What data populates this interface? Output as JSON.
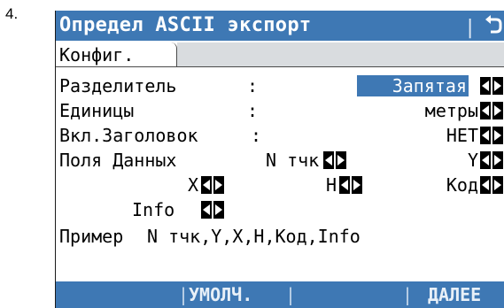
{
  "step_number": "4.",
  "title": "Определ ASCII экспорт",
  "title_separator": "|",
  "tabs": [
    "Конфиг."
  ],
  "fields": {
    "separator": {
      "label": "Разделитель",
      "colon": ":",
      "value": "Запятая"
    },
    "units": {
      "label": "Единицы",
      "colon": ":",
      "value": "метры"
    },
    "header": {
      "label": "Вкл.Заголовок",
      "colon": ":",
      "value": "НЕТ"
    }
  },
  "data_fields": {
    "label": "Поля Данных",
    "point_no": "N тчк",
    "y": "Y",
    "x": "X",
    "h": "H",
    "code": "Код",
    "info": "Info"
  },
  "example": {
    "label": "Пример",
    "text": "N тчк,Y,X,H,Код,Info"
  },
  "softkeys": {
    "default": "УМОЛЧ.",
    "next": "ДАЛЕЕ",
    "separator": "|"
  },
  "colors": {
    "accent": "#3e78b4",
    "selection_text": "#ffffff",
    "inactive_tab": "#d9dcdf"
  },
  "icons": [
    "back-icon",
    "left-right-arrows-icon"
  ]
}
